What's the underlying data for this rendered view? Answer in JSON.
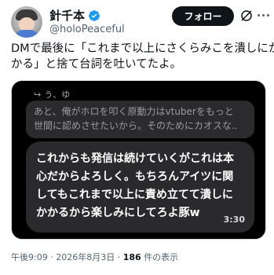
{
  "author": {
    "display_name": "針千本",
    "handle": "@holoPeaceful",
    "verified": true
  },
  "header": {
    "follow_label": "フォロー",
    "grok_icon": "grok-icon",
    "more_icon": "more-options-icon"
  },
  "tweet": {
    "text_lines": [
      "DMで最後に「これまで以上にさくらみこを潰しにか",
      "かる」と捨て台詞を吐いてたよ。"
    ]
  },
  "media": {
    "reply_arrow_icon": "reply-arrow-icon",
    "reply_to": "う、ゆ",
    "quoted_lines": [
      "あと、俺がホロを叩く原動力はvtuberをもっと",
      "世間に認めさせたいから。そのためにカオスな.."
    ],
    "message_lines": [
      "これからも発信は続けていくがこれは本",
      "心だからよろしく。もちろんアイツに関",
      "してもこれまで以上に責め立てて潰しに",
      "かかるから楽しみにしてろよ豚w"
    ],
    "message_time": "3:30"
  },
  "meta": {
    "time": "午後9:09",
    "separator": " · ",
    "date": "2026年8月3日",
    "views_count": "186",
    "views_label": " 件の表示"
  },
  "colors": {
    "verified_blue": "#1d9bf0",
    "follow_bg": "#0f1419",
    "secondary_text": "#536471"
  }
}
